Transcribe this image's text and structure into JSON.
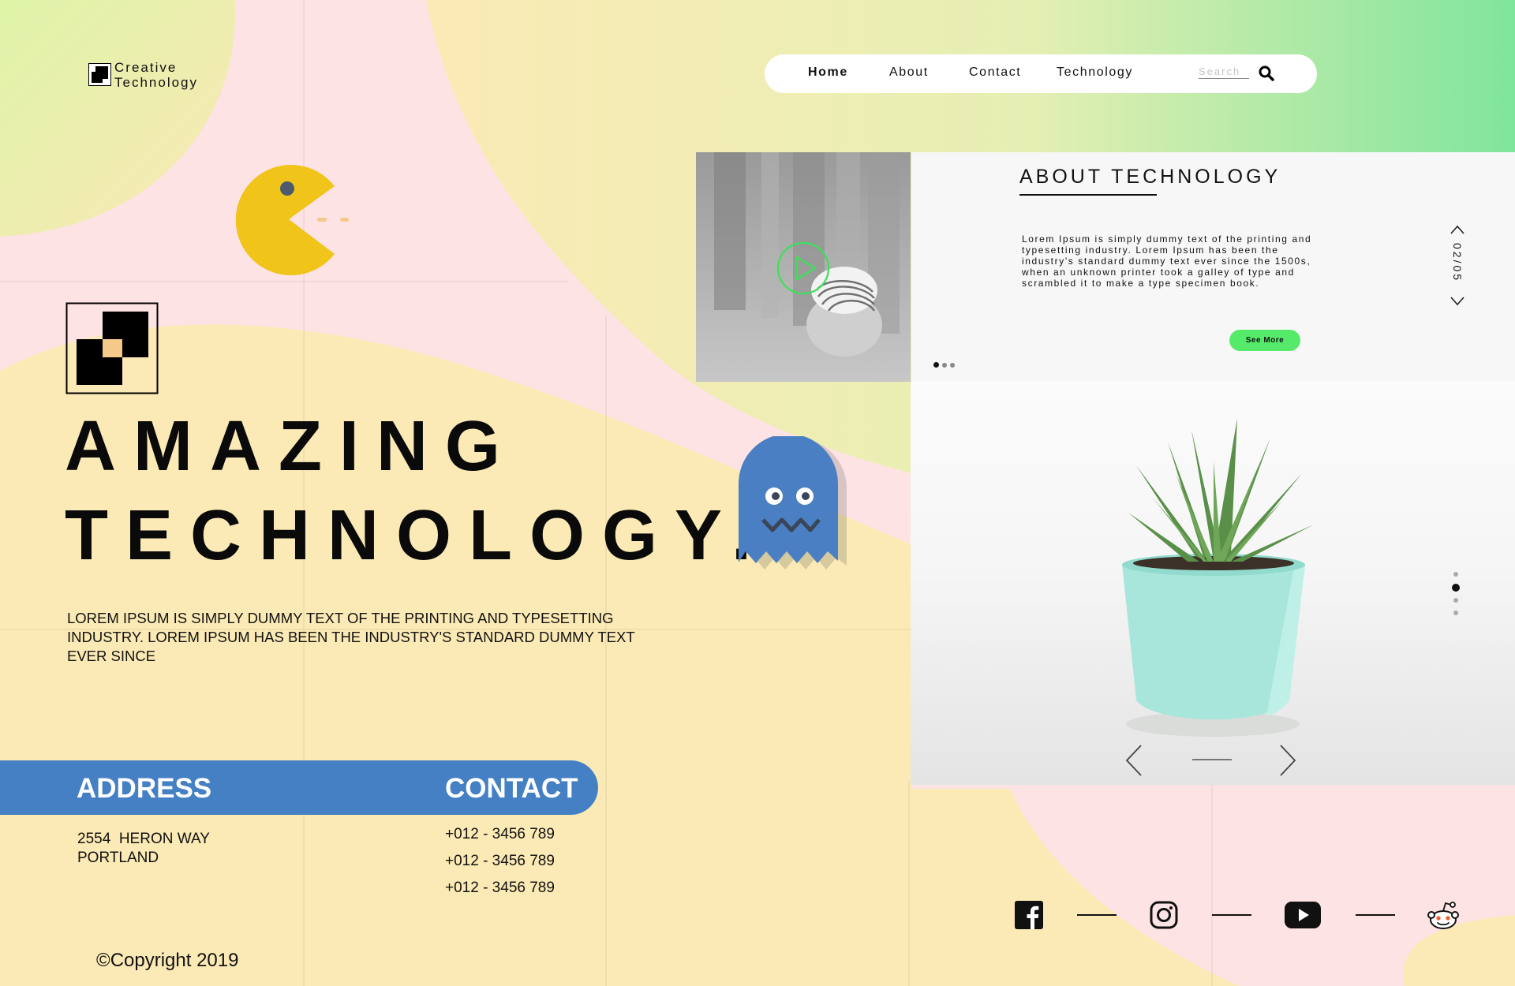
{
  "brand": {
    "line1": "Creative",
    "line2": "Technology"
  },
  "nav": {
    "items": [
      "Home",
      "About",
      "Contact",
      "Technology"
    ],
    "search_placeholder": "Search"
  },
  "hero": {
    "title_line1": "AMAZING",
    "title_line2": "TECHNOLOGY.",
    "description": "LOREM IPSUM IS SIMPLY DUMMY TEXT OF THE PRINTING AND TYPESETTING INDUSTRY. LOREM IPSUM HAS BEEN THE INDUSTRY'S STANDARD DUMMY TEXT EVER SINCE"
  },
  "about": {
    "title": "ABOUT TECHNOLOGY",
    "text": "Lorem Ipsum is simply dummy text of the printing and typesetting industry. Lorem Ipsum has been the industry's standard dummy text ever since the 1500s, when an unknown printer took a galley of type and scrambled it to make a type specimen book.",
    "button": "See More",
    "counter": "02/05"
  },
  "footer": {
    "address_title": "ADDRESS",
    "address_line1": "2554  HERON WAY",
    "address_line2": "PORTLAND",
    "contact_title": "CONTACT",
    "phones": [
      "+012 - 3456 789",
      "+012 - 3456 789",
      "+012 - 3456 789"
    ],
    "copyright": "Copyright 2019",
    "copyright_symbol": "©"
  },
  "social": [
    "facebook-icon",
    "instagram-icon",
    "youtube-icon",
    "reddit-icon"
  ],
  "colors": {
    "accent_green": "#55ea6a",
    "band_blue": "#4580c4",
    "pacman_yellow": "#f0c419",
    "ghost_blue": "#4a80c3",
    "bg_yellow": "#fbeab5",
    "bg_pink": "#fde3e3"
  }
}
